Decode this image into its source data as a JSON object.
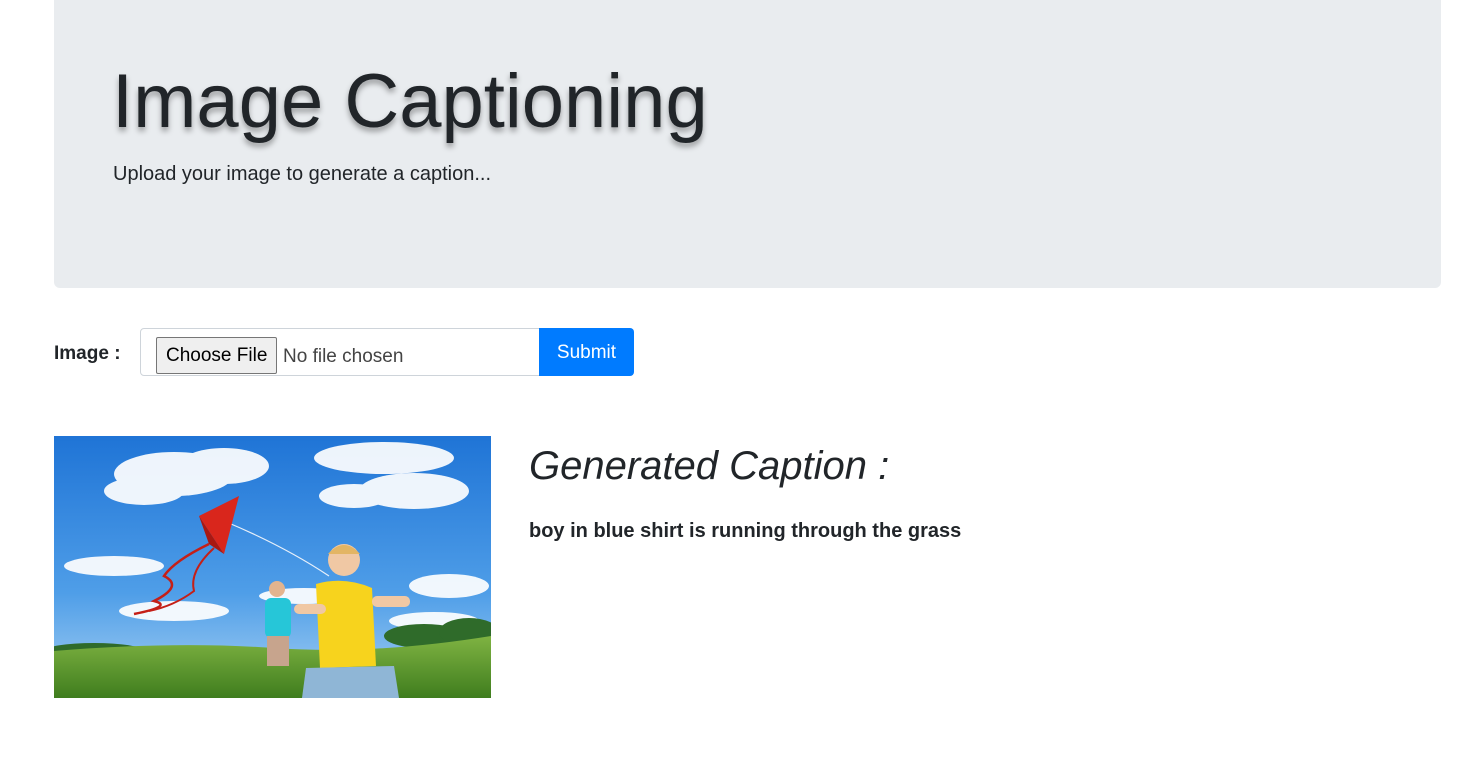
{
  "header": {
    "title": "Image Captioning",
    "subtitle": "Upload your image to generate a caption..."
  },
  "upload_form": {
    "label": "Image :",
    "choose_button": "Choose File",
    "file_status": "No file chosen",
    "submit_label": "Submit"
  },
  "result": {
    "heading": "Generated Caption :",
    "caption": "boy in blue shirt is running through the grass"
  },
  "colors": {
    "jumbotron_bg": "#e9ecef",
    "primary_button": "#007bff",
    "text": "#212529"
  }
}
